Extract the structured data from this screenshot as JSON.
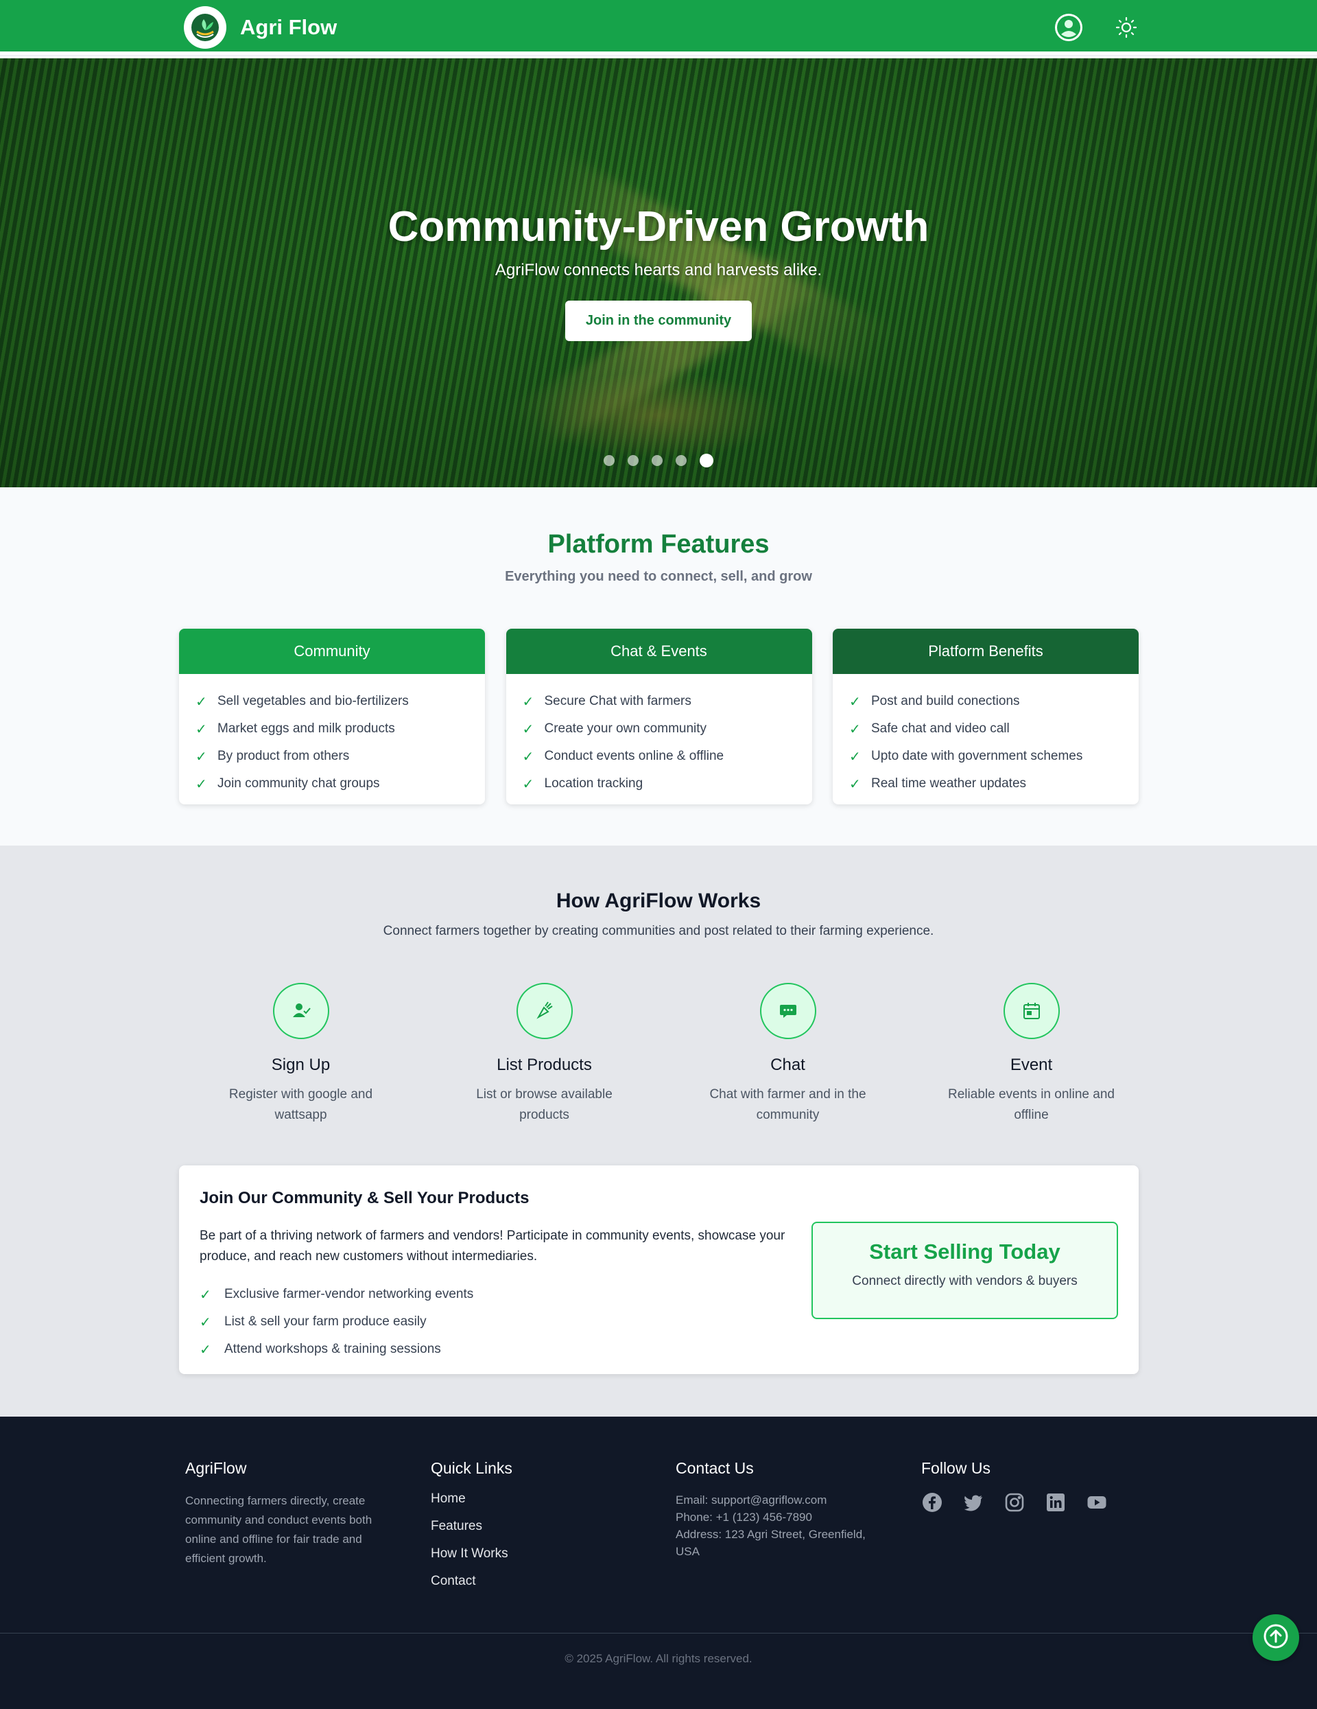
{
  "header": {
    "brand": "Agri Flow",
    "icons": [
      "leaf-logo-icon",
      "user-circle-icon",
      "sun-icon"
    ]
  },
  "hero": {
    "title": "Community-Driven Growth",
    "subtitle": "AgriFlow connects hearts and harvests alike.",
    "cta": "Join in the community",
    "slide_count": 5,
    "active_slide": 5
  },
  "features": {
    "title": "Platform Features",
    "subtitle": "Everything you need to connect, sell, and grow",
    "cards": [
      {
        "title": "Community",
        "color": "#16a34a",
        "items": [
          "Sell vegetables and bio-fertilizers",
          "Market eggs and milk products",
          "By product from others",
          "Join community chat groups"
        ]
      },
      {
        "title": "Chat & Events",
        "color": "#15803d",
        "items": [
          "Secure Chat with farmers",
          "Create your own community",
          "Conduct events online & offline",
          "Location tracking"
        ]
      },
      {
        "title": "Platform Benefits",
        "color": "#166534",
        "items": [
          "Post and build conections",
          "Safe chat and video call",
          "Upto date with government schemes",
          "Real time weather updates"
        ]
      }
    ]
  },
  "how": {
    "title": "How AgriFlow Works",
    "subtitle": "Connect farmers together by creating communities and post related to their farming experience.",
    "steps": [
      {
        "title": "Sign Up",
        "desc": "Register with google and wattsapp",
        "icon": "user-check-icon"
      },
      {
        "title": "List Products",
        "desc": "List or browse available products",
        "icon": "carrot-icon"
      },
      {
        "title": "Chat",
        "desc": "Chat with farmer and in the community",
        "icon": "chat-bubble-icon"
      },
      {
        "title": "Event",
        "desc": "Reliable events in online and offline",
        "icon": "calendar-icon"
      }
    ]
  },
  "join": {
    "title": "Join Our Community & Sell Your Products",
    "desc": "Be part of a thriving network of farmers and vendors! Participate in community events, showcase your produce, and reach new customers without intermediaries.",
    "items": [
      "Exclusive farmer-vendor networking events",
      "List & sell your farm produce easily",
      "Attend workshops & training sessions"
    ],
    "cta_title": "Start Selling Today",
    "cta_sub": "Connect directly with vendors & buyers"
  },
  "footer": {
    "about_title": "AgriFlow",
    "about_text": "Connecting farmers directly, create community and conduct events both online and offline for fair trade and efficient growth.",
    "links_title": "Quick Links",
    "links": [
      "Home",
      "Features",
      "How It Works",
      "Contact"
    ],
    "contact_title": "Contact Us",
    "email": "Email: support@agriflow.com",
    "phone": "Phone: +1 (123) 456-7890",
    "address": "Address: 123 Agri Street, Greenfield, USA",
    "follow_title": "Follow Us",
    "social": [
      "facebook-icon",
      "twitter-icon",
      "instagram-icon",
      "linkedin-icon",
      "youtube-icon"
    ],
    "copyright": "© 2025 AgriFlow. All rights reserved."
  },
  "colors": {
    "primary": "#16a34a",
    "footer_bg": "#111827"
  }
}
